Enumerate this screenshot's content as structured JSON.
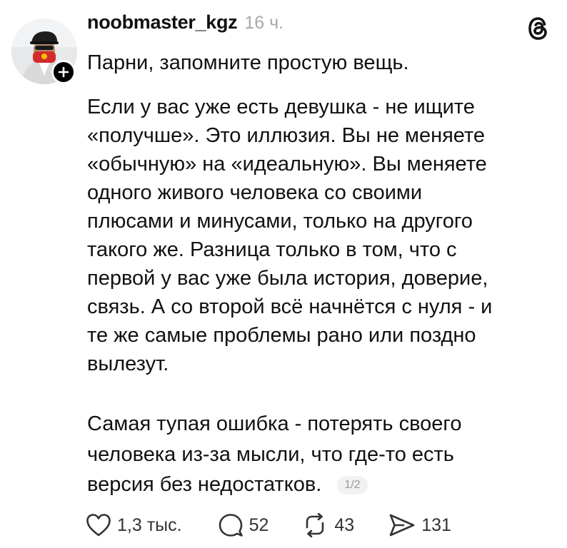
{
  "post": {
    "username": "noobmaster_kgz",
    "time": "16 ч.",
    "paragraphs": [
      "Парни, запомните простую вещь.",
      "Если у вас уже есть девушка - не ищите\n«получше». Это иллюзия. Вы не меняете\n«обычную» на «идеальную». Вы меняете\nодного живого человека со своими\nплюсами и минусами, только на другого\nтакого же. Разница только в том, что с\nпервой у вас уже была история, доверие,\nсвязь. А со второй всё начнётся с нуля - и\nте же самые проблемы рано или поздно\nвылезут.",
      "Самая тупая ошибка -  потерять своего\nчеловека из-за мысли, что где-то есть\nверсия без недостатков."
    ],
    "page_indicator": "1/2"
  },
  "actions": {
    "likes": "1,3 тыс.",
    "replies": "52",
    "reposts": "43",
    "shares": "131"
  },
  "icons": {
    "avatar": "profile-photo",
    "follow": "plus-icon",
    "logo": "threads-logo-icon",
    "like": "heart-icon",
    "reply": "comment-bubble-icon",
    "repost": "repost-icon",
    "share": "send-icon"
  },
  "colors": {
    "text": "#111111",
    "muted": "#a8a8a8",
    "badge_bg": "#000000"
  }
}
